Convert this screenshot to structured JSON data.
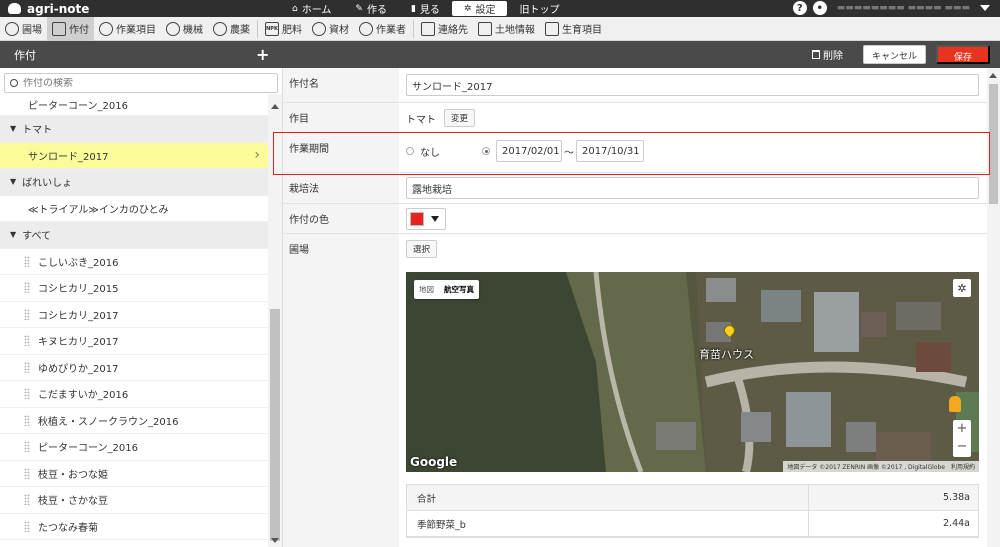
{
  "app": {
    "logo": "agri-note"
  },
  "topnav": [
    {
      "label": "ホーム",
      "icon": "home-icon"
    },
    {
      "label": "作る",
      "icon": "pencil-icon"
    },
    {
      "label": "見る",
      "icon": "book-icon"
    },
    {
      "label": "設定",
      "icon": "gear-icon"
    },
    {
      "label": "旧トップ",
      "icon": ""
    }
  ],
  "toolbar": {
    "modules": [
      {
        "label": "圃場",
        "icon": "map-pin-icon"
      },
      {
        "label": "作付",
        "icon": "document-icon"
      },
      {
        "label": "作業項目",
        "icon": "wave-icon"
      },
      {
        "label": "機械",
        "icon": "tractor-icon"
      },
      {
        "label": "農薬",
        "icon": "flask-icon"
      },
      {
        "label": "肥料",
        "icon": "npk-icon"
      },
      {
        "label": "資材",
        "icon": "wheelbarrow-icon"
      },
      {
        "label": "作業者",
        "icon": "person-icon"
      },
      {
        "label": "連絡先",
        "icon": "contact-book-icon"
      },
      {
        "label": "土地情報",
        "icon": "land-icon"
      },
      {
        "label": "生育項目",
        "icon": "growth-icon"
      }
    ]
  },
  "header": {
    "title": "作付",
    "add_label": "+",
    "delete_label": "削除",
    "cancel_label": "キャンセル",
    "save_label": "保存"
  },
  "sidebar": {
    "search_placeholder": "作付の検索",
    "top_partial": "ピーターコーン_2016",
    "groups": [
      {
        "label": "トマト",
        "items": [
          "サンロード_2017"
        ],
        "selected": "サンロード_2017"
      },
      {
        "label": "ばれいしょ",
        "items": [
          "≪トライアル≫インカのひとみ"
        ]
      },
      {
        "label": "すべて",
        "items": [
          "こしいぶき_2016",
          "コシヒカリ_2015",
          "コシヒカリ_2017",
          "キヌヒカリ_2017",
          "ゆめぴりか_2017",
          "こだますいか_2016",
          "秋植え・スノークラウン_2016",
          "ピーターコーン_2016",
          "枝豆・おつな姫",
          "枝豆・さかな豆",
          "たつなみ春菊"
        ]
      }
    ]
  },
  "form": {
    "name_label": "作付名",
    "name_value": "サンロード_2017",
    "item_label": "作目",
    "item_value": "トマト",
    "change_label": "変更",
    "period_label": "作業期間",
    "period_none_label": "なし",
    "period_start": "2017/02/01",
    "period_sep": "〜",
    "period_end": "2017/10/31",
    "method_label": "栽培法",
    "method_value": "露地栽培",
    "color_label": "作付の色",
    "color_value": "#e8221e",
    "field_label": "圃場",
    "select_label": "選択"
  },
  "map": {
    "type_map": "地図",
    "type_satellite": "航空写真",
    "pin_label": "育苗ハウス",
    "google_label": "Google",
    "attribution": "地図データ ©2017 ZENRIN 画像 ©2017 , DigitalGlobe　利用規約"
  },
  "area": {
    "rows": [
      {
        "name": "合計",
        "value": "5.38a"
      },
      {
        "name": "季節野菜_b",
        "value": "2.44a"
      }
    ]
  }
}
